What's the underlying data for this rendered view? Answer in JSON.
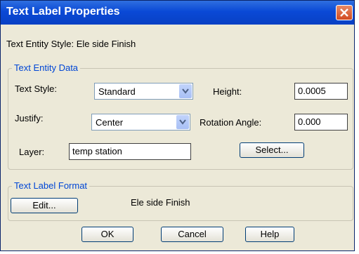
{
  "window": {
    "title": "Text Label Properties"
  },
  "entity_style_line": "Text Entity Style: Ele side Finish",
  "text_entity_data": {
    "legend": "Text Entity Data",
    "text_style_label": "Text Style:",
    "text_style_value": "Standard",
    "height_label": "Height:",
    "height_value": "0.0005",
    "justify_label": "Justify:",
    "justify_value": "Center",
    "rotation_label": "Rotation Angle:",
    "rotation_value": "0.000",
    "layer_label": "Layer:",
    "layer_value": "temp station",
    "select_button": "Select..."
  },
  "text_label_format": {
    "legend": "Text Label Format",
    "edit_button": "Edit...",
    "format_value": "Ele side Finish"
  },
  "buttons": {
    "ok": "OK",
    "cancel": "Cancel",
    "help": "Help"
  },
  "colors": {
    "titlebar": "#0a49d6",
    "legend_text": "#0046d5",
    "dialog_bg": "#ece9d8"
  }
}
